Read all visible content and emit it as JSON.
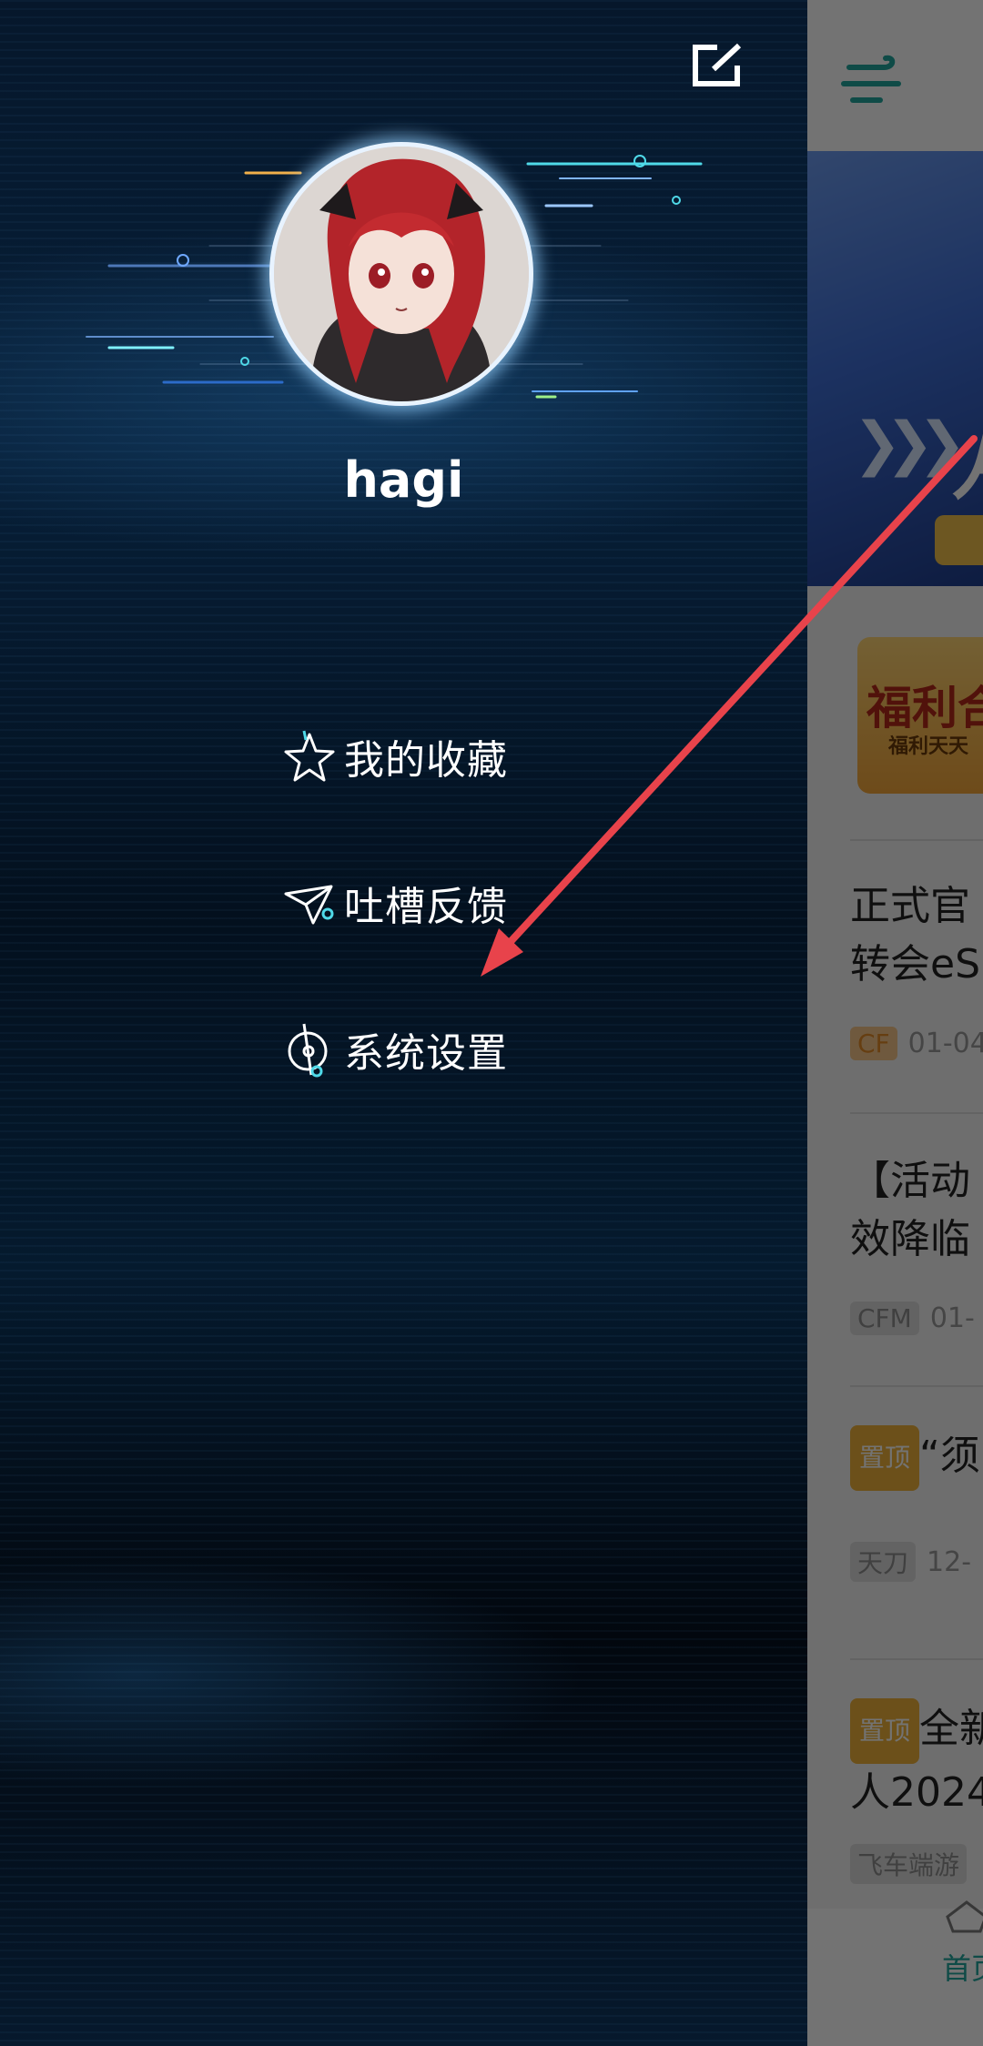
{
  "drawer": {
    "username": "hagi",
    "menu": [
      {
        "label": "我的收藏",
        "icon": "star-icon"
      },
      {
        "label": "吐槽反馈",
        "icon": "paper-plane-icon"
      },
      {
        "label": "系统设置",
        "icon": "settings-compass-icon"
      }
    ]
  },
  "background_app": {
    "promo": {
      "title": "福利合",
      "subtitle": "福利天天"
    },
    "articles": [
      {
        "line1": "正式官",
        "line2": "转会eS",
        "tag": "CF",
        "date": "01-04"
      },
      {
        "line1": "【活动",
        "line2": "效降临",
        "tag": "CFM",
        "date": "01-"
      },
      {
        "pin": "置顶",
        "line1": "“须",
        "tag": "天刀",
        "date": "12-"
      },
      {
        "pin": "置顶",
        "line1": "全新",
        "line2": "人2024",
        "tag": "飞车端游"
      }
    ],
    "nav_home_label": "首页"
  },
  "colors": {
    "annotation_arrow": "#e8434b",
    "accent": "#22a79e"
  }
}
